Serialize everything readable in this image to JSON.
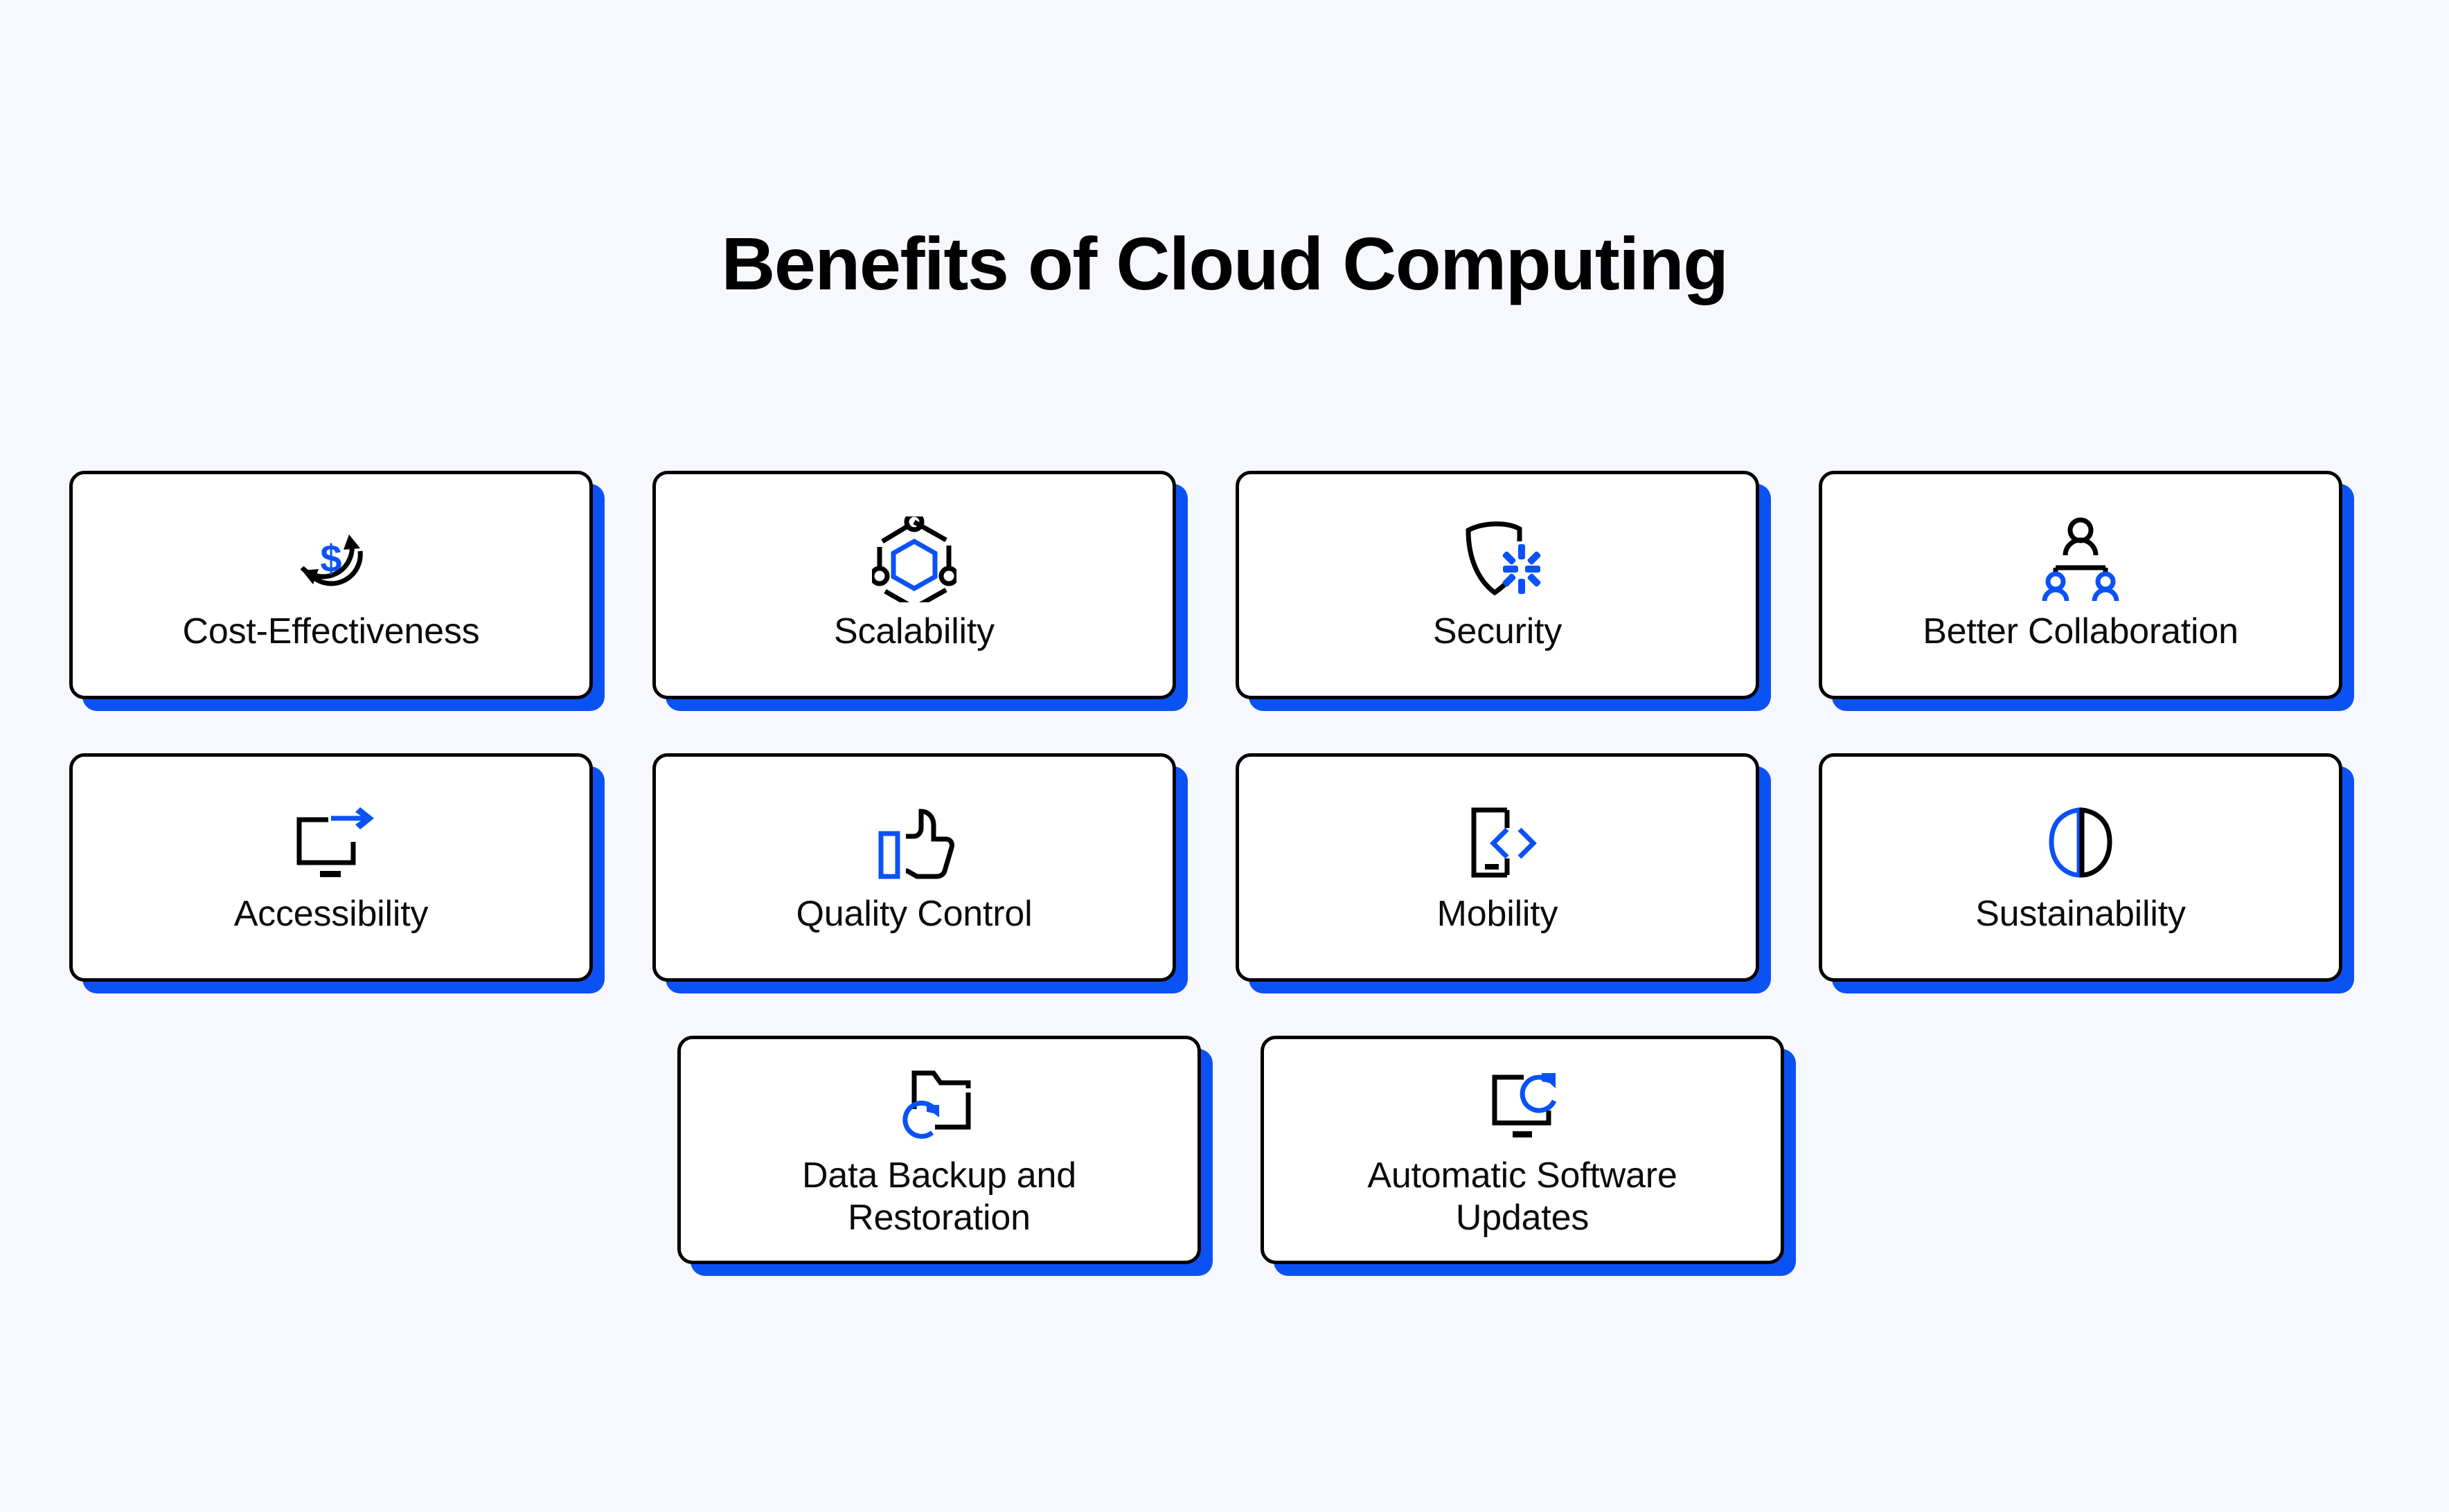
{
  "page": {
    "title": "Benefits of Cloud Computing",
    "background_color": "#f7f8fd",
    "accent_color": "#0b52f5",
    "text_color": "#000000",
    "card_background": "#ffffff",
    "card_border_color": "#000000"
  },
  "grid": {
    "rows": [
      {
        "cards": [
          {
            "label": "Cost-Effectiveness",
            "icon": "dollar-refresh-icon"
          },
          {
            "label": "Scalability",
            "icon": "hexagon-network-icon"
          },
          {
            "label": "Security",
            "icon": "shield-burst-icon"
          },
          {
            "label": "Better Collaboration",
            "icon": "org-chart-people-icon"
          }
        ]
      },
      {
        "cards": [
          {
            "label": "Accessibility",
            "icon": "monitor-arrow-icon"
          },
          {
            "label": "Quality Control",
            "icon": "thumbs-up-icon"
          },
          {
            "label": "Mobility",
            "icon": "phone-code-icon"
          },
          {
            "label": "Sustainability",
            "icon": "two-leaves-icon"
          }
        ]
      },
      {
        "cards": [
          {
            "label": "Data Backup and\nRestoration",
            "icon": "folder-refresh-icon"
          },
          {
            "label": "Automatic Software\nUpdates",
            "icon": "monitor-refresh-icon"
          }
        ]
      }
    ]
  }
}
